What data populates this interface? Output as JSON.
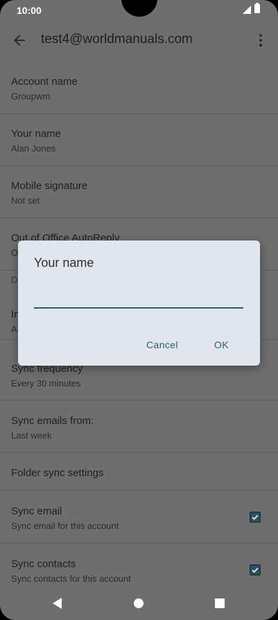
{
  "status_bar": {
    "time": "10:00"
  },
  "toolbar": {
    "title": "test4@worldmanuals.com"
  },
  "settings": {
    "account_name": {
      "title": "Account name",
      "summary": "Groupwm"
    },
    "your_name": {
      "title": "Your name",
      "summary": "Alan Jones"
    },
    "mobile_signature": {
      "title": "Mobile signature",
      "summary": "Not set"
    },
    "out_of_office": {
      "title": "Out of Office AutoReply",
      "summary": "O"
    },
    "section_letter": {
      "title": "D"
    },
    "inbox_row": {
      "title": "In",
      "summary": "A"
    },
    "sync_frequency": {
      "title": "Sync frequency",
      "summary": "Every 30 minutes"
    },
    "sync_emails_from": {
      "title": "Sync emails from:",
      "summary": "Last week"
    },
    "folder_sync": {
      "title": "Folder sync settings"
    },
    "sync_email": {
      "title": "Sync email",
      "summary": "Sync email for this account",
      "checked": true
    },
    "sync_contacts": {
      "title": "Sync contacts",
      "summary": "Sync contacts for this account",
      "checked": true
    }
  },
  "dialog": {
    "title": "Your name",
    "input_value": "",
    "cancel_label": "Cancel",
    "ok_label": "OK"
  },
  "colors": {
    "scrim_background": "#6e6e6e",
    "dialog_background": "#e1e6ee",
    "accent": "#2e5c6d"
  }
}
